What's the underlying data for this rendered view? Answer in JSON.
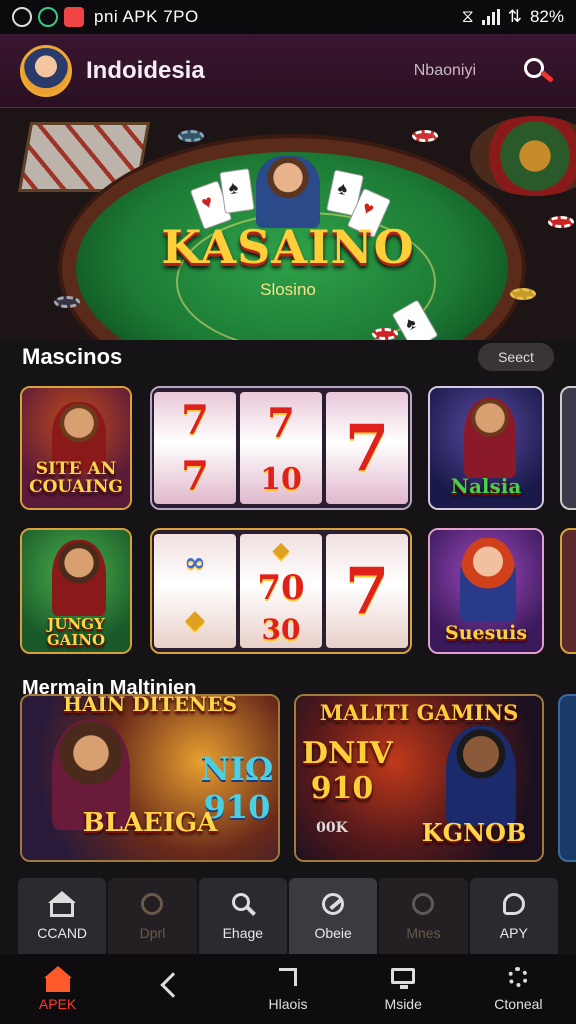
{
  "status_bar": {
    "title": "pni APK 7PO",
    "battery": "82%"
  },
  "header": {
    "brand": "Indoidesia",
    "nav_link": "Nbaoniyi"
  },
  "hero": {
    "title": "KASAINO",
    "subtitle": "Slosino"
  },
  "section_casinos": {
    "title": "Mascinos",
    "select_label": "Seect"
  },
  "games": [
    {
      "caption": "SITE AN COUAING"
    },
    {
      "reels": [
        "7",
        "7",
        "7",
        "7",
        "10",
        "7"
      ]
    },
    {
      "caption": "Nalsia"
    },
    {
      "caption": "JUNGY GAINO"
    },
    {
      "reels": [
        "",
        "",
        "7",
        "",
        "70",
        "",
        "",
        "30",
        "7"
      ]
    },
    {
      "caption": "Suesuis"
    }
  ],
  "section_multi": {
    "title": "Mermain Maltinien"
  },
  "banners": [
    {
      "top": "HAIN DITENES",
      "number": "NIΩ 910",
      "caption": "BLAEIGA"
    },
    {
      "top": "MALITI GAMINS",
      "number": "DNIV 910",
      "small": "00K",
      "caption": "KGNOB"
    }
  ],
  "tabs": [
    {
      "label": "CCAND"
    },
    {
      "label": "Dprl"
    },
    {
      "label": "Ehage"
    },
    {
      "label": "Obeie"
    },
    {
      "label": "Mnes"
    },
    {
      "label": "APY"
    }
  ],
  "nav": [
    {
      "label": "APEK"
    },
    {
      "label": ""
    },
    {
      "label": "Hlaois"
    },
    {
      "label": "Mside"
    },
    {
      "label": "Ctoneal"
    }
  ],
  "colors": {
    "accent": "#ff3a2a",
    "header_bg": "#3a1630",
    "gold": "#ffcf3a"
  }
}
